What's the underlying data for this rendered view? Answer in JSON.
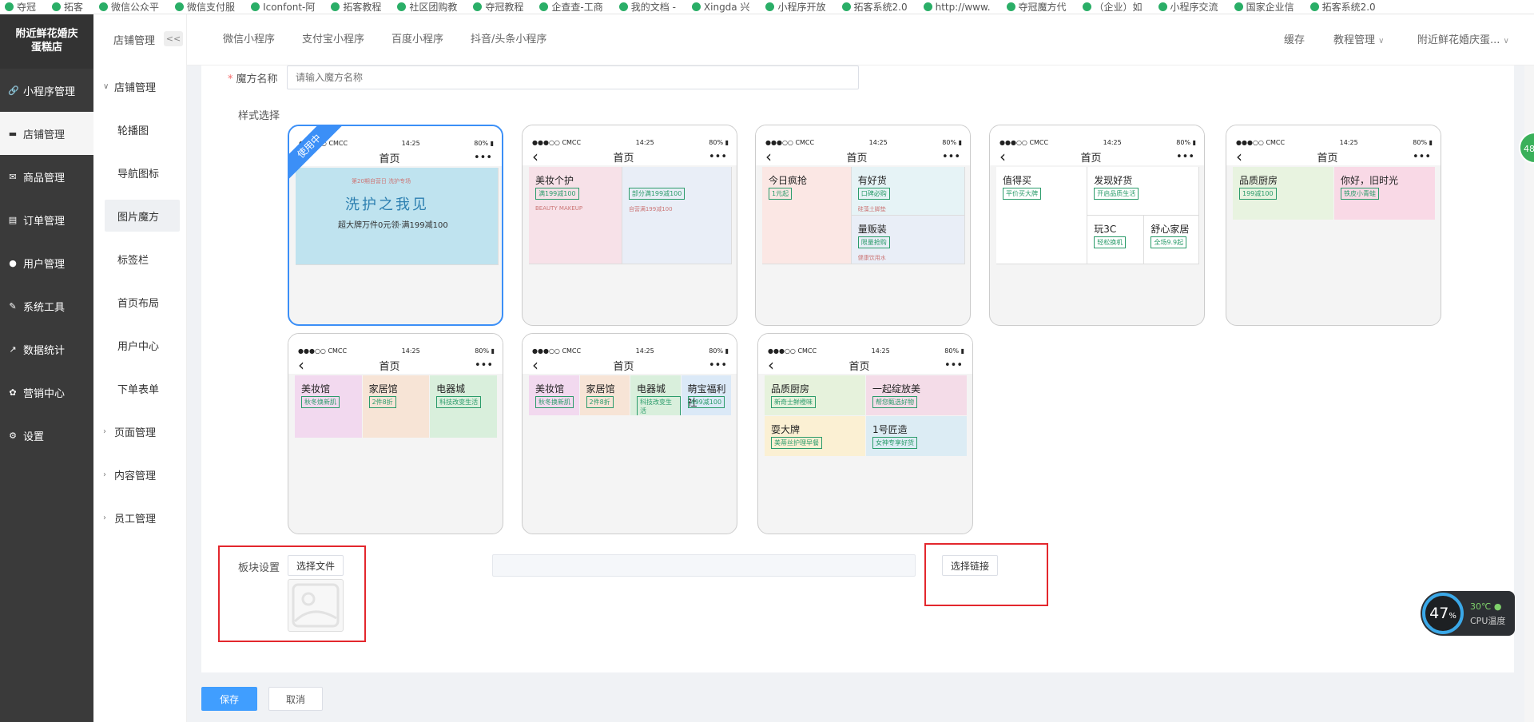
{
  "bookmarks": [
    "夺冠",
    "拓客",
    "微信公众平",
    "微信支付服",
    "Iconfont-阿",
    "拓客教程",
    "社区团购教",
    "夺冠教程",
    "企查查-工商",
    "我的文档 -",
    "Xingda 兴",
    "小程序开放",
    "拓客系统2.0",
    "http://www.",
    "夺冠魔方代",
    "（企业）如",
    "小程序交流",
    "国家企业信",
    "拓客系统2.0"
  ],
  "sidebar": {
    "shop_name": "附近鲜花婚庆蛋糕店",
    "items": [
      {
        "label": "小程序管理",
        "icon": "link-icon",
        "glyph": "🔗"
      },
      {
        "label": "店铺管理",
        "icon": "shop-icon",
        "glyph": "▬"
      },
      {
        "label": "商品管理",
        "icon": "goods-icon",
        "glyph": "✉"
      },
      {
        "label": "订单管理",
        "icon": "order-icon",
        "glyph": "▤"
      },
      {
        "label": "用户管理",
        "icon": "user-icon",
        "glyph": "●"
      },
      {
        "label": "系统工具",
        "icon": "wrench-icon",
        "glyph": "✎"
      },
      {
        "label": "数据统计",
        "icon": "chart-icon",
        "glyph": "↗"
      },
      {
        "label": "营销中心",
        "icon": "marketing-icon",
        "glyph": "✿"
      },
      {
        "label": "设置",
        "icon": "settings-icon",
        "glyph": "⚙"
      }
    ]
  },
  "subnav": {
    "title": "店铺管理",
    "collapse": "<<",
    "group": "店铺管理",
    "items": [
      "轮播图",
      "导航图标",
      "图片魔方",
      "标签栏",
      "首页布局",
      "用户中心",
      "下单表单"
    ],
    "groups_collapsed": [
      "页面管理",
      "内容管理",
      "员工管理"
    ]
  },
  "topbar": {
    "tabs": [
      "微信小程序",
      "支付宝小程序",
      "百度小程序",
      "抖音/头条小程序"
    ],
    "cache": "缓存",
    "tutorial": "教程管理",
    "shop": "附近鲜花婚庆蛋..."
  },
  "form": {
    "name_label": "魔方名称",
    "name_placeholder": "请输入魔方名称",
    "style_label": "样式选择",
    "block_label": "板块设置",
    "choose_file": "选择文件",
    "choose_link": "选择链接",
    "save": "保存",
    "cancel": "取消"
  },
  "phone": {
    "carrier": "●●●○○ CMCC",
    "time": "14:25",
    "battery": "80%",
    "title": "首页",
    "more": "•••",
    "back": "‹",
    "in_use": "使用中"
  },
  "styles": [
    {
      "tiles": [
        {
          "title": "洗护之我见",
          "sub": "超大牌万件0元领·满199减100",
          "note": "第20期自营日 洗护专场",
          "color": "#bfe3ef"
        }
      ]
    },
    {
      "tiles": [
        {
          "title": "美妆个护",
          "sub": "满199减100",
          "note": "BEAUTY MAKEUP",
          "color": "#f7e1e8"
        },
        {
          "title": "",
          "sub": "部分满199减100",
          "note": "自营满199减100",
          "color": "#e9eef7"
        }
      ]
    },
    {
      "tiles": [
        {
          "title": "今日疯抢",
          "sub": "1元起",
          "note": "",
          "color": "#fbe7e4"
        },
        {
          "title": "有好货",
          "sub": "口碑必购",
          "note": "硅藻土脚垫",
          "color": "#e6f3f6"
        },
        {
          "title": "量贩装",
          "sub": "限量抢购",
          "note": "健康饮用水",
          "color": "#e9eef7"
        }
      ]
    },
    {
      "tiles": [
        {
          "title": "值得买",
          "sub": "平价买大牌",
          "note": "",
          "color": "#ffffff"
        },
        {
          "title": "发现好货",
          "sub": "开启品质生活",
          "note": "",
          "color": "#ffffff"
        },
        {
          "title": "玩3C",
          "sub": "轻松换机",
          "note": "",
          "color": "#ffffff"
        },
        {
          "title": "舒心家居",
          "sub": "全场9.9起",
          "note": "",
          "color": "#ffffff"
        }
      ]
    },
    {
      "tiles": [
        {
          "title": "品质厨房",
          "sub": "199减100",
          "note": "",
          "color": "#e8f3e0"
        },
        {
          "title": "你好，旧时光",
          "sub": "铁皮小青蛙",
          "note": "",
          "color": "#f9d9e6"
        }
      ]
    },
    {
      "tiles": [
        {
          "title": "美妆馆",
          "sub": "秋冬焕新肌",
          "note": "",
          "color": "#f2d9ef"
        },
        {
          "title": "家居馆",
          "sub": "2件8折",
          "note": "",
          "color": "#f7e4d6"
        },
        {
          "title": "电器城",
          "sub": "科技改变生活",
          "note": "",
          "color": "#d9efdc"
        }
      ]
    },
    {
      "tiles": [
        {
          "title": "美妆馆",
          "sub": "秋冬换新肌",
          "note": "",
          "color": "#f2d9ef"
        },
        {
          "title": "家居馆",
          "sub": "2件8折",
          "note": "",
          "color": "#f7e4d6"
        },
        {
          "title": "电器城",
          "sub": "科技改变生活",
          "note": "",
          "color": "#d9efdc"
        },
        {
          "title": "萌宝福利社",
          "sub": "499减100",
          "note": "",
          "color": "#dbe9f7"
        }
      ]
    },
    {
      "tiles": [
        {
          "title": "品质厨房",
          "sub": "新奇士鲜橙味",
          "note": "",
          "color": "#e6f2dc"
        },
        {
          "title": "一起绽放美",
          "sub": "帮您甄选好物",
          "note": "",
          "color": "#f4dce8"
        },
        {
          "title": "耍大牌",
          "sub": "美蒂丝护理早餐",
          "note": "",
          "color": "#fbf0d3"
        },
        {
          "title": "1号匠造",
          "sub": "女神专享好货",
          "note": "",
          "color": "#dcecf4"
        }
      ]
    }
  ],
  "cpu": {
    "percent": "47",
    "unit": "%",
    "temp": "30℃",
    "label": "CPU温度"
  },
  "side_badge": "48"
}
